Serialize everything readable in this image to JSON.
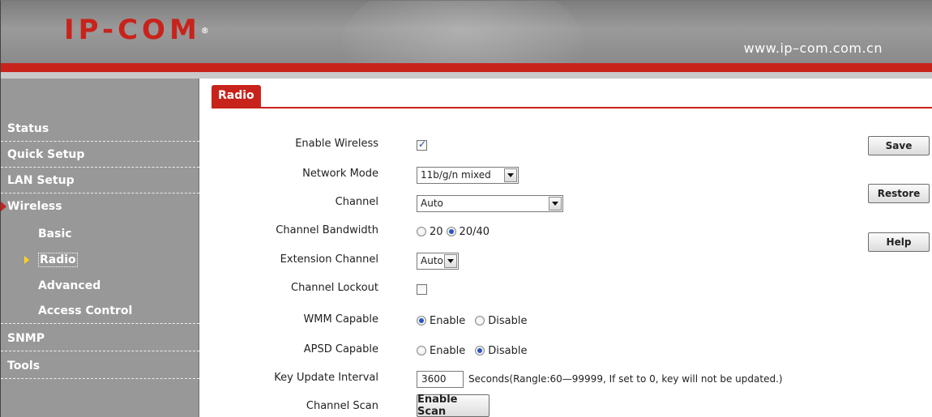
{
  "header": {
    "logo": "IP-COM",
    "logo_mark": "®",
    "url": "www.ip–com.com.cn",
    "colors": {
      "brand_red": "#c8231b",
      "header_gray": "#8f8f8f",
      "sidebar_gray": "#989898"
    }
  },
  "sidebar": {
    "items": [
      {
        "label": "Status"
      },
      {
        "label": "Quick Setup"
      },
      {
        "label": "LAN Setup"
      },
      {
        "label": "Wireless"
      },
      {
        "label": "Basic"
      },
      {
        "label": "Radio"
      },
      {
        "label": "Advanced"
      },
      {
        "label": "Access Control"
      },
      {
        "label": "SNMP"
      },
      {
        "label": "Tools"
      }
    ]
  },
  "tab": {
    "label": "Radio"
  },
  "form": {
    "enable_wireless": {
      "label": "Enable Wireless",
      "checked": true
    },
    "network_mode": {
      "label": "Network Mode",
      "value": "11b/g/n mixed"
    },
    "channel": {
      "label": "Channel",
      "value": "Auto"
    },
    "channel_bandwidth": {
      "label": "Channel Bandwidth",
      "options": [
        "20",
        "20/40"
      ],
      "selected": "20/40"
    },
    "extension_channel": {
      "label": "Extension Channel",
      "value": "Auto"
    },
    "channel_lockout": {
      "label": "Channel Lockout",
      "checked": false
    },
    "wmm_capable": {
      "label": "WMM Capable",
      "options": [
        "Enable",
        "Disable"
      ],
      "selected": "Enable"
    },
    "apsd_capable": {
      "label": "APSD Capable",
      "options": [
        "Enable",
        "Disable"
      ],
      "selected": "Disable"
    },
    "key_update_interval": {
      "label": "Key Update Interval",
      "value": "3600",
      "hint": "Seconds(Rangle:60—99999, If set to 0, key will not be updated.)"
    },
    "channel_scan": {
      "label": "Channel Scan",
      "button": "Enable Scan"
    }
  },
  "actions": {
    "save": "Save",
    "restore": "Restore",
    "help": "Help"
  }
}
